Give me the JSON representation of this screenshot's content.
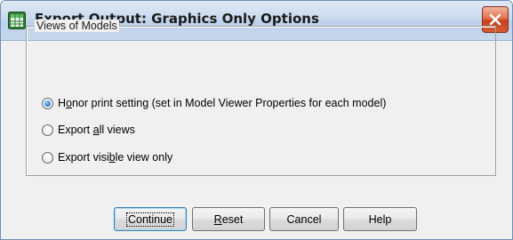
{
  "window": {
    "title": "Export Output: Graphics Only Options",
    "app_icon": "spss-table-icon",
    "close_icon": "close-icon"
  },
  "group": {
    "legend": "Views of Models",
    "options": [
      {
        "pre": "H",
        "u": "o",
        "post": "nor print setting (set in Model Viewer Properties for each model)",
        "checked": true
      },
      {
        "pre": "Export ",
        "u": "a",
        "post": "ll views",
        "checked": false
      },
      {
        "pre": "Export visi",
        "u": "b",
        "post": "le view only",
        "checked": false
      }
    ]
  },
  "buttons": {
    "continue": {
      "pre": "",
      "u": "",
      "post": "Continue"
    },
    "reset": {
      "pre": "",
      "u": "R",
      "post": "eset"
    },
    "cancel": {
      "pre": "",
      "u": "",
      "post": "Cancel"
    },
    "help": {
      "pre": "",
      "u": "",
      "post": "Help"
    }
  },
  "colors": {
    "titlebar": "#c9daee",
    "close_button": "#d65a33",
    "dialog_bg": "#f0f0f0",
    "radio_selected": "#2f7fd0"
  }
}
